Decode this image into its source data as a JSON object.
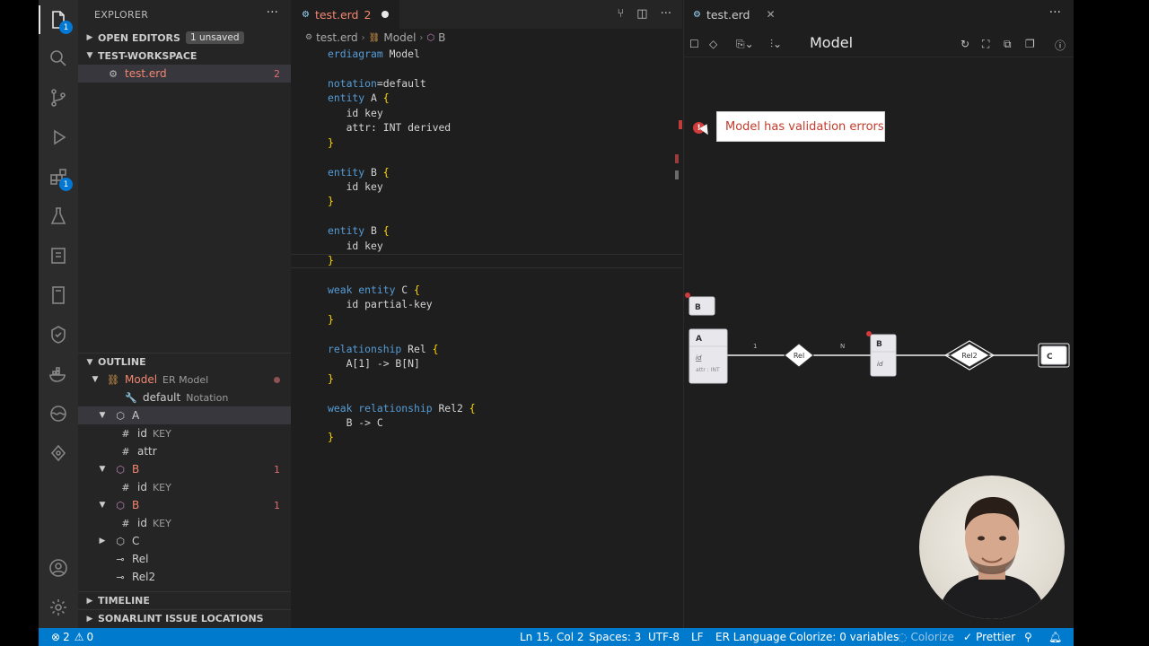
{
  "activity": {
    "scm_badge": "1",
    "ext_badge": "1"
  },
  "explorer": {
    "title": "EXPLORER",
    "open_editors": "OPEN EDITORS",
    "unsaved": "1 unsaved",
    "workspace": "TEST-WORKSPACE",
    "file": {
      "name": "test.erd",
      "errors": "2"
    }
  },
  "outline": {
    "title": "OUTLINE",
    "items": [
      {
        "label": "Model",
        "sub": "ER Model"
      },
      {
        "label": "default",
        "sub": "Notation"
      },
      {
        "label": "A",
        "sub": ""
      },
      {
        "label": "id",
        "sub": "KEY"
      },
      {
        "label": "attr",
        "sub": ""
      },
      {
        "label": "B",
        "sub": "",
        "count": "1"
      },
      {
        "label": "id",
        "sub": "KEY"
      },
      {
        "label": "B",
        "sub": "",
        "count": "1"
      },
      {
        "label": "id",
        "sub": "KEY"
      },
      {
        "label": "C",
        "sub": ""
      },
      {
        "label": "Rel",
        "sub": ""
      },
      {
        "label": "Rel2",
        "sub": ""
      }
    ]
  },
  "sections": {
    "timeline": "TIMELINE",
    "sonar": "SONARLINT ISSUE LOCATIONS"
  },
  "editor": {
    "tab": {
      "name": "test.erd",
      "problems": "2"
    },
    "breadcrumb": [
      "test.erd",
      "Model",
      "B"
    ],
    "lines": [
      "erdiagram Model",
      "",
      "notation=default",
      "entity A {",
      "   id key",
      "   attr: INT derived",
      "}",
      "",
      "entity B {",
      "   id key",
      "}",
      "",
      "entity B {",
      "   id key",
      "}",
      "",
      "weak entity C {",
      "   id partial-key",
      "}",
      "",
      "relationship Rel {",
      "   A[1] -> B[N]",
      "}",
      "",
      "weak relationship Rel2 {",
      "   B -> C",
      "}"
    ]
  },
  "diagram": {
    "tab": "test.erd",
    "title": "Model",
    "tooltip": "Model has validation errors",
    "nodes": {
      "b_floating": "B",
      "a": {
        "name": "A",
        "attr1": "id",
        "attr2": "attr : INT"
      },
      "rel": "Rel",
      "card1": "1",
      "cardN": "N",
      "b": {
        "name": "B",
        "attr1": "id"
      },
      "rel2": "Rel2",
      "c": "C"
    }
  },
  "status": {
    "errors": "2",
    "warnings": "0",
    "position": "Ln 15, Col 2",
    "spaces": "Spaces: 3",
    "encoding": "UTF-8",
    "eol": "LF",
    "language": "ER Language",
    "colorize_vars": "Colorize: 0 variables",
    "colorize": "Colorize",
    "prettier": "Prettier"
  }
}
